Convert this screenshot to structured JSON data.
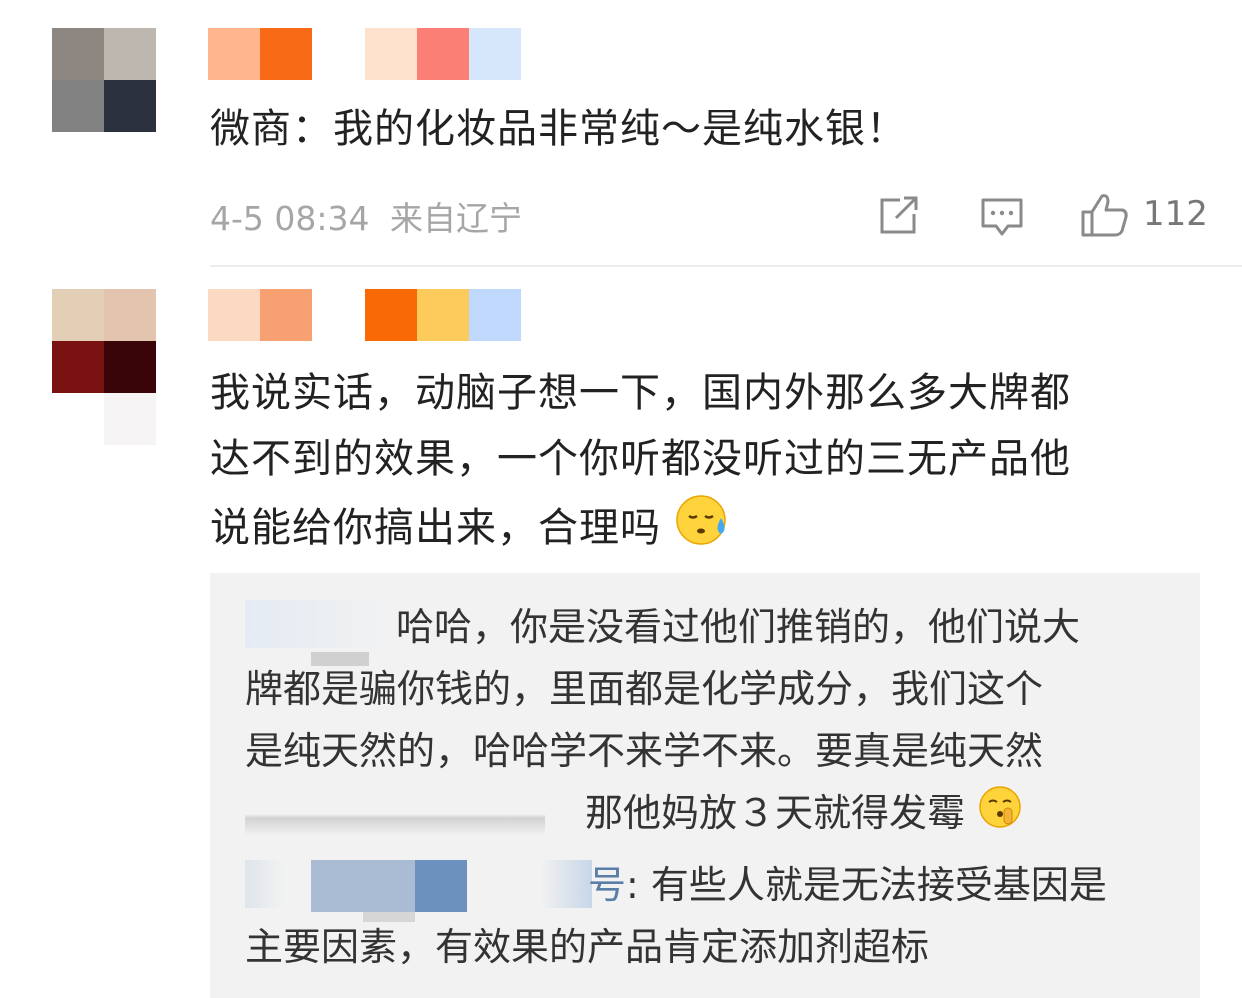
{
  "comments": [
    {
      "text": "微商：我的化妆品非常纯～是纯水银！",
      "time": "4-5 08:34",
      "location": "来自辽宁",
      "likes": "112",
      "icons": [
        "share-icon",
        "comment-icon",
        "thumbs-up-icon"
      ]
    },
    {
      "text_line1": "我说实话，动脑子想一下，国内外那么多大牌都",
      "text_line2": "达不到的效果，一个你听都没听过的三无产品他",
      "text_line3": "说能给你搞出来，合理吗",
      "emoji": "sweat-face-emoji"
    }
  ],
  "replies": [
    {
      "line1": "哈哈，你是没看过他们推销的，他们说大",
      "line2": "牌都是骗你钱的，里面都是化学成分，我们这个",
      "line3": "是纯天然的，哈哈学不来学不来。要真是纯天然",
      "line4": "那他妈放３天就得发霉",
      "emoji": "shushing-face-emoji"
    },
    {
      "name_tail": "号",
      "line1": ": 有些人就是无法接受基因是",
      "line2": "主要因素，有效果的产品肯定添加剂超标"
    }
  ]
}
